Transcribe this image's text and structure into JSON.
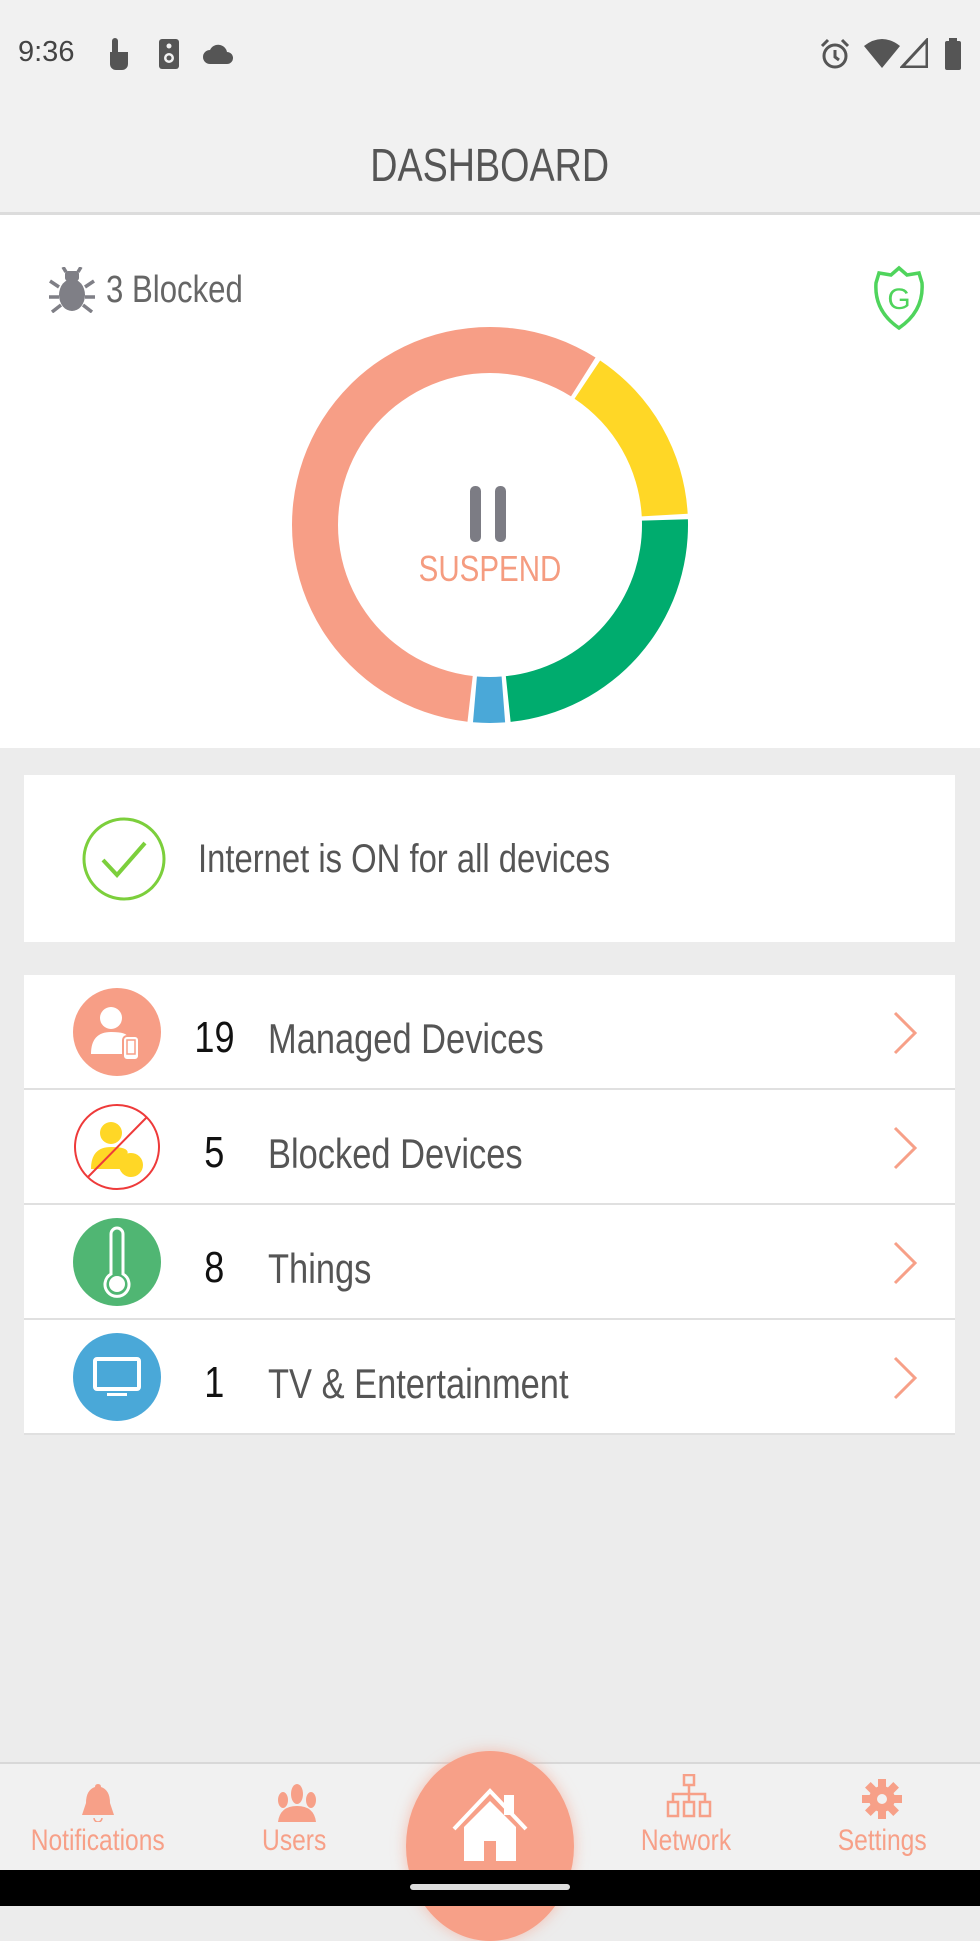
{
  "status_bar": {
    "time": "9:36",
    "left_icons": [
      "touch-icon",
      "speaker-icon",
      "cloud-icon"
    ],
    "right_icons": [
      "alarm-icon",
      "wifi-icon",
      "signal-icon",
      "battery-icon"
    ]
  },
  "header": {
    "title": "DASHBOARD"
  },
  "summary": {
    "blocked_label": "3 Blocked",
    "shield_letter": "G",
    "suspend_label": "SUSPEND"
  },
  "chart_data": {
    "type": "pie",
    "style": "donut",
    "series": [
      {
        "category": "Blocked Devices",
        "value": 5,
        "color": "#ffd726"
      },
      {
        "category": "Things",
        "value": 8,
        "color": "#00ac6e"
      },
      {
        "category": "TV & Entertainment",
        "value": 1,
        "color": "#4aa8d8"
      },
      {
        "category": "Managed Devices",
        "value": 19,
        "color": "#f79e86"
      }
    ]
  },
  "internet_status": {
    "text": "Internet is ON for all devices",
    "color": "#7ccf3c"
  },
  "devices": [
    {
      "count": "19",
      "label": "Managed Devices",
      "icon": "managed-user-icon",
      "color": "#f79e86"
    },
    {
      "count": "5",
      "label": "Blocked Devices",
      "icon": "blocked-user-icon",
      "color": "#ffd726"
    },
    {
      "count": "8",
      "label": "Things",
      "icon": "thermometer-icon",
      "color": "#50b673"
    },
    {
      "count": "1",
      "label": "TV & Entertainment",
      "icon": "tv-icon",
      "color": "#4aa8d8"
    }
  ],
  "nav": {
    "items": [
      {
        "label": "Notifications",
        "icon": "bell-icon"
      },
      {
        "label": "Users",
        "icon": "users-icon"
      },
      {
        "label": "",
        "icon": "home-icon",
        "active": true
      },
      {
        "label": "Network",
        "icon": "network-icon"
      },
      {
        "label": "Settings",
        "icon": "gear-icon"
      }
    ]
  },
  "colors": {
    "accent": "#f7a088",
    "text": "#555555"
  }
}
